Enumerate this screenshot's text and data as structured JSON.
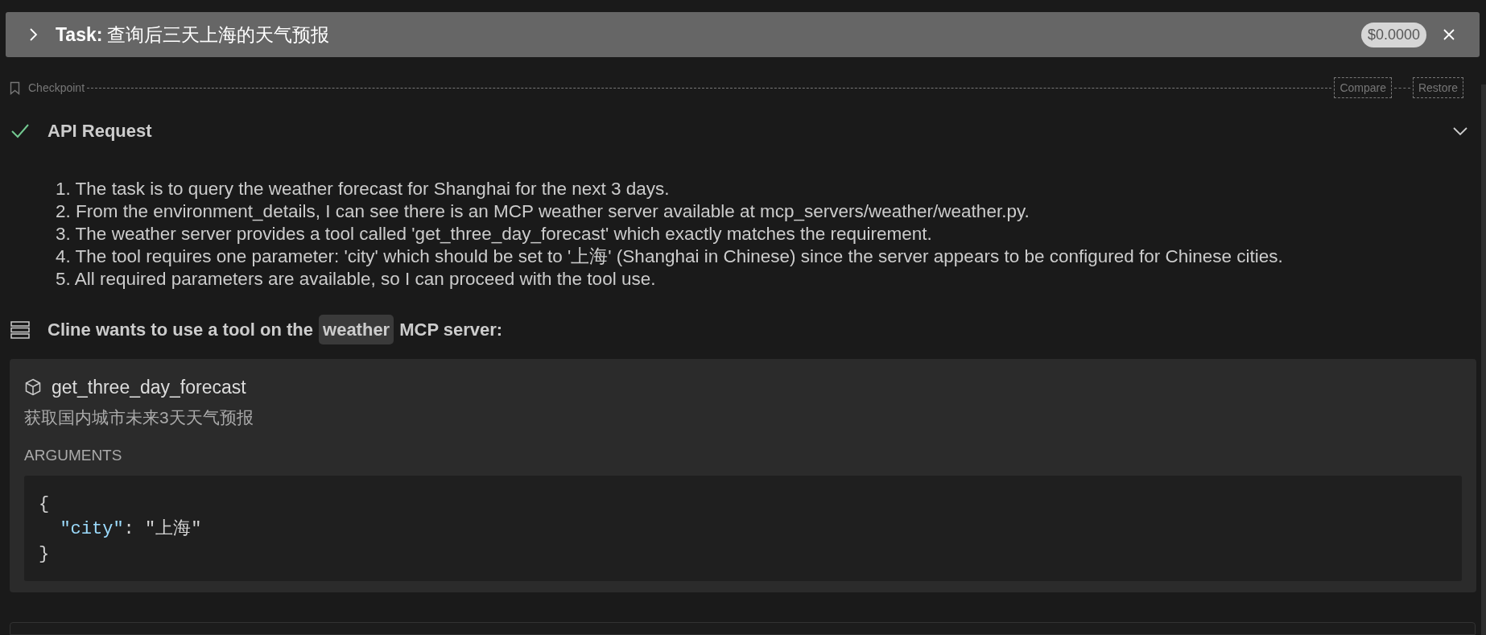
{
  "task": {
    "label": "Task:",
    "title": "查询后三天上海的天气预报",
    "cost": "$0.0000"
  },
  "checkpoint": {
    "label": "Checkpoint",
    "buttons": [
      "Compare",
      "Restore"
    ]
  },
  "api_request": {
    "title": "API Request",
    "reasoning": [
      "1. The task is to query the weather forecast for Shanghai for the next 3 days.",
      "2. From the environment_details, I can see there is an MCP weather server available at mcp_servers/weather/weather.py.",
      "3. The weather server provides a tool called 'get_three_day_forecast' which exactly matches the requirement.",
      "4. The tool requires one parameter: 'city' which should be set to '上海' (Shanghai in Chinese) since the server appears to be configured for Chinese cities.",
      "5. All required parameters are available, so I can proceed with the tool use."
    ]
  },
  "tool_request": {
    "before": "Cline wants to use a tool on the",
    "server": "weather",
    "after": "MCP server:"
  },
  "tool": {
    "name": "get_three_day_forecast",
    "description": "获取国内城市未来3天天气预报",
    "arguments_label": "ARGUMENTS",
    "code": [
      [
        {
          "kind": "punct",
          "text": "{"
        }
      ],
      [
        {
          "kind": "key",
          "text": "\"city\"",
          "indent": true
        },
        {
          "kind": "punct",
          "text": ": "
        },
        {
          "kind": "string",
          "text": "\"上海\""
        }
      ],
      [
        {
          "kind": "punct",
          "text": "}"
        }
      ]
    ]
  }
}
